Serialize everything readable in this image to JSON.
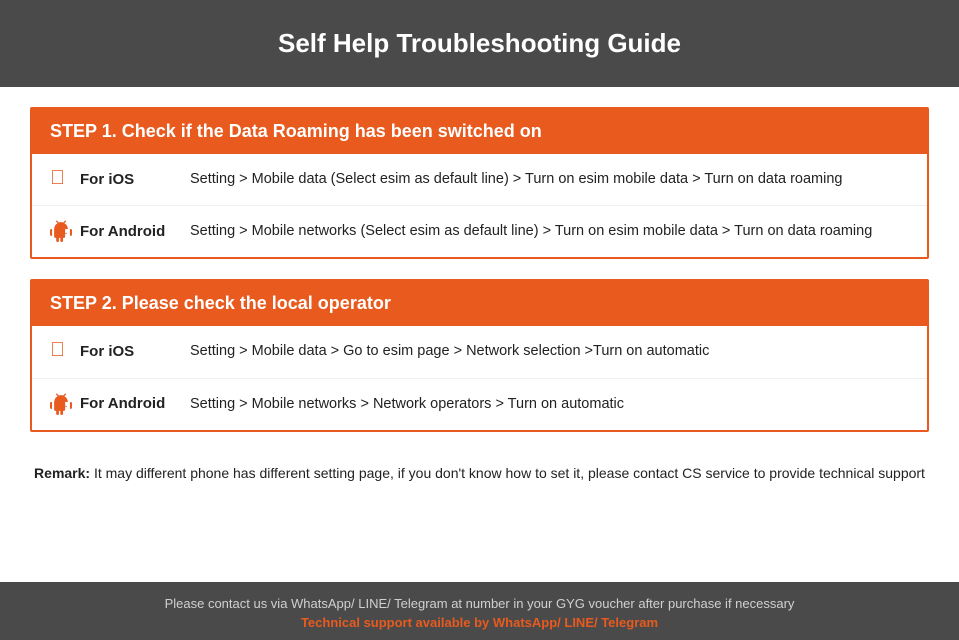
{
  "header": {
    "title": "Self Help Troubleshooting Guide"
  },
  "step1": {
    "title": "STEP 1.  Check if the Data Roaming has been switched on",
    "ios": {
      "label": "For iOS",
      "description": "Setting > Mobile data (Select esim as default line) > Turn on esim mobile data > Turn on data roaming"
    },
    "android": {
      "label": "For Android",
      "description": "Setting > Mobile networks (Select esim as default line) > Turn on esim mobile data > Turn on data roaming"
    }
  },
  "step2": {
    "title": "STEP 2.  Please check the local operator",
    "ios": {
      "label": "For iOS",
      "description": "Setting > Mobile data > Go to esim page > Network selection >Turn on automatic"
    },
    "android": {
      "label": "For Android",
      "description": "Setting > Mobile networks > Network operators > Turn on automatic"
    }
  },
  "remark": {
    "prefix": "Remark:",
    "text": " It may different phone has different setting page, if you don't know how to set it,  please contact CS service to provide technical support"
  },
  "footer": {
    "main_text": "Please contact us via WhatsApp/ LINE/ Telegram at number in your GYG voucher after purchase if necessary",
    "support_text": "Technical support available by WhatsApp/ LINE/ Telegram"
  }
}
